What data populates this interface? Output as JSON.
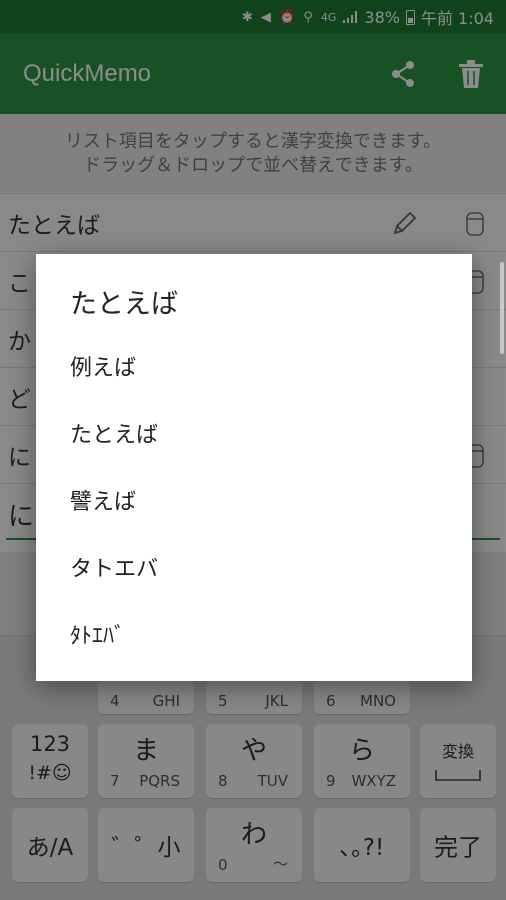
{
  "status": {
    "battery": "38%",
    "time": "午前 1:04",
    "network": "4G"
  },
  "app": {
    "title": "QuickMemo",
    "share_icon": "share-icon",
    "delete_icon": "trash-icon",
    "colors": {
      "bar": "#2a9442",
      "status": "#1e7b2e"
    }
  },
  "hint": {
    "line1": "リスト項目をタップすると漢字変換できます。",
    "line2": "ドラッグ＆ドロップで並べ替えできます。"
  },
  "list": [
    {
      "text": "たとえば"
    },
    {
      "text": "こ"
    },
    {
      "text": "か"
    },
    {
      "text": "ど"
    },
    {
      "text": "に"
    }
  ],
  "input": {
    "value": "に"
  },
  "keyboard": {
    "row_top": {
      "k4": "4",
      "k4b": "GHI",
      "k5": "5",
      "k5b": "JKL",
      "k6": "6",
      "k6b": "MNO"
    },
    "k123": "123",
    "k123b": "!#☺",
    "ma": "ま",
    "ma_num": "7",
    "ma_letters": "PQRS",
    "ya": "や",
    "ya_num": "8",
    "ya_letters": "TUV",
    "ra": "ら",
    "ra_num": "9",
    "ra_letters": "WXYZ",
    "henkan": "変換",
    "kana": "あ/A",
    "small": "゛゜小",
    "wa": "わ",
    "wa_num": "0",
    "wa_sym": "～",
    "punct": "､｡?!",
    "done": "完了"
  },
  "dialog": {
    "title": "たとえば",
    "options": [
      "例えば",
      "たとえば",
      "譬えば",
      "タトエバ",
      "ﾀﾄｴﾊﾞ"
    ]
  }
}
